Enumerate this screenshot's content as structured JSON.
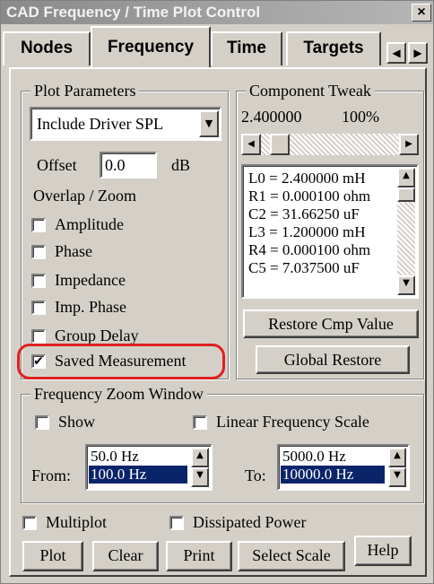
{
  "window": {
    "title": "CAD Frequency / Time Plot Control",
    "close": "×"
  },
  "tabs": [
    "Nodes",
    "Frequency",
    "Time",
    "Targets"
  ],
  "tab_scroll": {
    "left": "◀",
    "right": "▶"
  },
  "plot_params": {
    "title": "Plot Parameters",
    "dropdown_value": "Include Driver SPL",
    "offset_label": "Offset",
    "offset_value": "0.0",
    "offset_unit": "dB",
    "overlap_label": "Overlap / Zoom",
    "checks": [
      {
        "label": "Amplitude",
        "checked": false
      },
      {
        "label": "Phase",
        "checked": false
      },
      {
        "label": "Impedance",
        "checked": false
      },
      {
        "label": "Imp. Phase",
        "checked": false
      },
      {
        "label": "Group Delay",
        "checked": false
      },
      {
        "label": "Saved Measurement",
        "checked": true
      }
    ]
  },
  "component_tweak": {
    "title": "Component Tweak",
    "value": "2.400000",
    "percent": "100%",
    "list": [
      "L0 = 2.400000 mH",
      "R1 = 0.000100 ohm",
      "C2 = 31.66250 uF",
      "L3 = 1.200000 mH",
      "R4 = 0.000100 ohm",
      "C5 = 7.037500 uF"
    ],
    "restore_btn": "Restore Cmp Value",
    "global_restore_btn": "Global Restore"
  },
  "zoom_window": {
    "title": "Frequency Zoom Window",
    "show_label": "Show",
    "linear_label": "Linear Frequency Scale",
    "from_label": "From:",
    "from_items": [
      "50.0 Hz",
      "100.0 Hz"
    ],
    "to_label": "To:",
    "to_items": [
      "5000.0 Hz",
      "10000.0 Hz"
    ]
  },
  "bottom": {
    "multiplot": "Multiplot",
    "dissipated": "Dissipated Power",
    "buttons": [
      "Plot",
      "Clear",
      "Print",
      "Select Scale",
      "Help"
    ]
  }
}
